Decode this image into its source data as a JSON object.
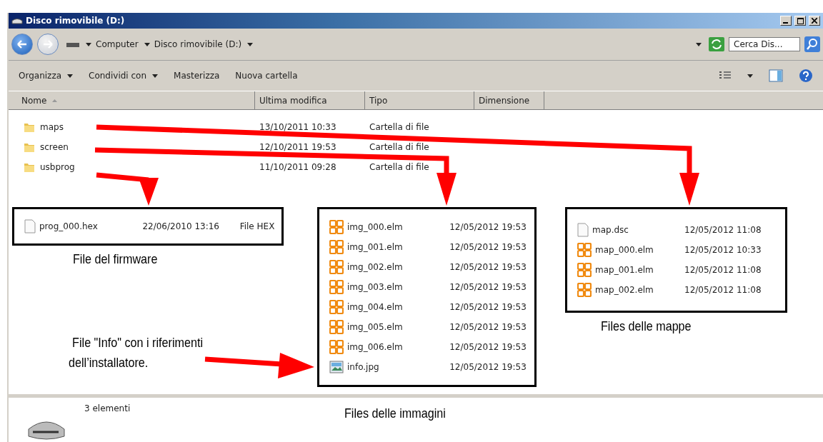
{
  "window": {
    "title": "Disco rimovibile (D:)"
  },
  "address": {
    "crumbs": [
      "Computer",
      "Disco rimovibile (D:)"
    ]
  },
  "search": {
    "placeholder": "Cerca Dis..."
  },
  "toolbar": [
    {
      "label": "Organizza",
      "dropdown": true
    },
    {
      "label": "Condividi con",
      "dropdown": true
    },
    {
      "label": "Masterizza",
      "dropdown": false
    },
    {
      "label": "Nuova cartella",
      "dropdown": false
    }
  ],
  "columns": [
    "Nome",
    "Ultima modifica",
    "Tipo",
    "Dimensione"
  ],
  "rows": [
    {
      "name": "maps",
      "modified": "13/10/2011 10:33",
      "type": "Cartella di file"
    },
    {
      "name": "screen",
      "modified": "12/10/2011 19:53",
      "type": "Cartella di file"
    },
    {
      "name": "usbprog",
      "modified": "11/10/2011 09:28",
      "type": "Cartella di file"
    }
  ],
  "callouts": [
    {
      "caption": "File del firmware",
      "files": [
        {
          "kind": "doc",
          "name": "prog_000.hex",
          "modified": "22/06/2010 13:16",
          "type": "File HEX"
        }
      ]
    },
    {
      "caption": "Files delle immagini",
      "files": [
        {
          "kind": "elm",
          "name": "img_000.elm",
          "modified": "12/05/2012 19:53"
        },
        {
          "kind": "elm",
          "name": "img_001.elm",
          "modified": "12/05/2012 19:53"
        },
        {
          "kind": "elm",
          "name": "img_002.elm",
          "modified": "12/05/2012 19:53"
        },
        {
          "kind": "elm",
          "name": "img_003.elm",
          "modified": "12/05/2012 19:53"
        },
        {
          "kind": "elm",
          "name": "img_004.elm",
          "modified": "12/05/2012 19:53"
        },
        {
          "kind": "elm",
          "name": "img_005.elm",
          "modified": "12/05/2012 19:53"
        },
        {
          "kind": "elm",
          "name": "img_006.elm",
          "modified": "12/05/2012 19:53"
        },
        {
          "kind": "image",
          "name": "info.jpg",
          "modified": "12/05/2012 19:53"
        }
      ]
    },
    {
      "caption": "Files delle mappe",
      "files": [
        {
          "kind": "doc",
          "name": "map.dsc",
          "modified": "12/05/2012 11:08"
        },
        {
          "kind": "elm",
          "name": "map_000.elm",
          "modified": "12/05/2012 10:33"
        },
        {
          "kind": "elm",
          "name": "map_001.elm",
          "modified": "12/05/2012 11:08"
        },
        {
          "kind": "elm",
          "name": "map_002.elm",
          "modified": "12/05/2012 11:08"
        }
      ]
    }
  ],
  "note": "File \"Info\" con i riferimenti dell’installatore.",
  "status": "3 elementi"
}
